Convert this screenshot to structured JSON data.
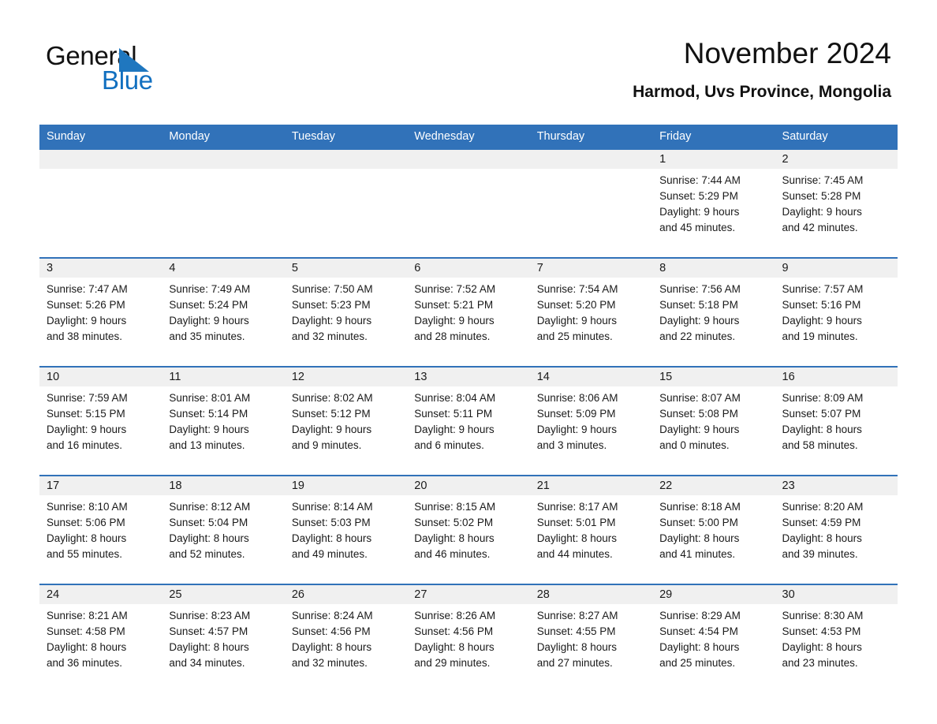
{
  "brand": {
    "name_part1": "General",
    "name_part2": "Blue",
    "accent_color": "#1270c0",
    "triangle_color": "#1f77bf"
  },
  "header": {
    "month_title": "November 2024",
    "location": "Harmod, Uvs Province, Mongolia"
  },
  "calendar": {
    "header_bg": "#3172b9",
    "daynum_bg": "#f0f0f0",
    "weekday_headers": [
      "Sunday",
      "Monday",
      "Tuesday",
      "Wednesday",
      "Thursday",
      "Friday",
      "Saturday"
    ],
    "weeks": [
      [
        {
          "day": "",
          "sunrise": "",
          "sunset": "",
          "daylight_line1": "",
          "daylight_line2": ""
        },
        {
          "day": "",
          "sunrise": "",
          "sunset": "",
          "daylight_line1": "",
          "daylight_line2": ""
        },
        {
          "day": "",
          "sunrise": "",
          "sunset": "",
          "daylight_line1": "",
          "daylight_line2": ""
        },
        {
          "day": "",
          "sunrise": "",
          "sunset": "",
          "daylight_line1": "",
          "daylight_line2": ""
        },
        {
          "day": "",
          "sunrise": "",
          "sunset": "",
          "daylight_line1": "",
          "daylight_line2": ""
        },
        {
          "day": "1",
          "sunrise": "Sunrise: 7:44 AM",
          "sunset": "Sunset: 5:29 PM",
          "daylight_line1": "Daylight: 9 hours",
          "daylight_line2": "and 45 minutes."
        },
        {
          "day": "2",
          "sunrise": "Sunrise: 7:45 AM",
          "sunset": "Sunset: 5:28 PM",
          "daylight_line1": "Daylight: 9 hours",
          "daylight_line2": "and 42 minutes."
        }
      ],
      [
        {
          "day": "3",
          "sunrise": "Sunrise: 7:47 AM",
          "sunset": "Sunset: 5:26 PM",
          "daylight_line1": "Daylight: 9 hours",
          "daylight_line2": "and 38 minutes."
        },
        {
          "day": "4",
          "sunrise": "Sunrise: 7:49 AM",
          "sunset": "Sunset: 5:24 PM",
          "daylight_line1": "Daylight: 9 hours",
          "daylight_line2": "and 35 minutes."
        },
        {
          "day": "5",
          "sunrise": "Sunrise: 7:50 AM",
          "sunset": "Sunset: 5:23 PM",
          "daylight_line1": "Daylight: 9 hours",
          "daylight_line2": "and 32 minutes."
        },
        {
          "day": "6",
          "sunrise": "Sunrise: 7:52 AM",
          "sunset": "Sunset: 5:21 PM",
          "daylight_line1": "Daylight: 9 hours",
          "daylight_line2": "and 28 minutes."
        },
        {
          "day": "7",
          "sunrise": "Sunrise: 7:54 AM",
          "sunset": "Sunset: 5:20 PM",
          "daylight_line1": "Daylight: 9 hours",
          "daylight_line2": "and 25 minutes."
        },
        {
          "day": "8",
          "sunrise": "Sunrise: 7:56 AM",
          "sunset": "Sunset: 5:18 PM",
          "daylight_line1": "Daylight: 9 hours",
          "daylight_line2": "and 22 minutes."
        },
        {
          "day": "9",
          "sunrise": "Sunrise: 7:57 AM",
          "sunset": "Sunset: 5:16 PM",
          "daylight_line1": "Daylight: 9 hours",
          "daylight_line2": "and 19 minutes."
        }
      ],
      [
        {
          "day": "10",
          "sunrise": "Sunrise: 7:59 AM",
          "sunset": "Sunset: 5:15 PM",
          "daylight_line1": "Daylight: 9 hours",
          "daylight_line2": "and 16 minutes."
        },
        {
          "day": "11",
          "sunrise": "Sunrise: 8:01 AM",
          "sunset": "Sunset: 5:14 PM",
          "daylight_line1": "Daylight: 9 hours",
          "daylight_line2": "and 13 minutes."
        },
        {
          "day": "12",
          "sunrise": "Sunrise: 8:02 AM",
          "sunset": "Sunset: 5:12 PM",
          "daylight_line1": "Daylight: 9 hours",
          "daylight_line2": "and 9 minutes."
        },
        {
          "day": "13",
          "sunrise": "Sunrise: 8:04 AM",
          "sunset": "Sunset: 5:11 PM",
          "daylight_line1": "Daylight: 9 hours",
          "daylight_line2": "and 6 minutes."
        },
        {
          "day": "14",
          "sunrise": "Sunrise: 8:06 AM",
          "sunset": "Sunset: 5:09 PM",
          "daylight_line1": "Daylight: 9 hours",
          "daylight_line2": "and 3 minutes."
        },
        {
          "day": "15",
          "sunrise": "Sunrise: 8:07 AM",
          "sunset": "Sunset: 5:08 PM",
          "daylight_line1": "Daylight: 9 hours",
          "daylight_line2": "and 0 minutes."
        },
        {
          "day": "16",
          "sunrise": "Sunrise: 8:09 AM",
          "sunset": "Sunset: 5:07 PM",
          "daylight_line1": "Daylight: 8 hours",
          "daylight_line2": "and 58 minutes."
        }
      ],
      [
        {
          "day": "17",
          "sunrise": "Sunrise: 8:10 AM",
          "sunset": "Sunset: 5:06 PM",
          "daylight_line1": "Daylight: 8 hours",
          "daylight_line2": "and 55 minutes."
        },
        {
          "day": "18",
          "sunrise": "Sunrise: 8:12 AM",
          "sunset": "Sunset: 5:04 PM",
          "daylight_line1": "Daylight: 8 hours",
          "daylight_line2": "and 52 minutes."
        },
        {
          "day": "19",
          "sunrise": "Sunrise: 8:14 AM",
          "sunset": "Sunset: 5:03 PM",
          "daylight_line1": "Daylight: 8 hours",
          "daylight_line2": "and 49 minutes."
        },
        {
          "day": "20",
          "sunrise": "Sunrise: 8:15 AM",
          "sunset": "Sunset: 5:02 PM",
          "daylight_line1": "Daylight: 8 hours",
          "daylight_line2": "and 46 minutes."
        },
        {
          "day": "21",
          "sunrise": "Sunrise: 8:17 AM",
          "sunset": "Sunset: 5:01 PM",
          "daylight_line1": "Daylight: 8 hours",
          "daylight_line2": "and 44 minutes."
        },
        {
          "day": "22",
          "sunrise": "Sunrise: 8:18 AM",
          "sunset": "Sunset: 5:00 PM",
          "daylight_line1": "Daylight: 8 hours",
          "daylight_line2": "and 41 minutes."
        },
        {
          "day": "23",
          "sunrise": "Sunrise: 8:20 AM",
          "sunset": "Sunset: 4:59 PM",
          "daylight_line1": "Daylight: 8 hours",
          "daylight_line2": "and 39 minutes."
        }
      ],
      [
        {
          "day": "24",
          "sunrise": "Sunrise: 8:21 AM",
          "sunset": "Sunset: 4:58 PM",
          "daylight_line1": "Daylight: 8 hours",
          "daylight_line2": "and 36 minutes."
        },
        {
          "day": "25",
          "sunrise": "Sunrise: 8:23 AM",
          "sunset": "Sunset: 4:57 PM",
          "daylight_line1": "Daylight: 8 hours",
          "daylight_line2": "and 34 minutes."
        },
        {
          "day": "26",
          "sunrise": "Sunrise: 8:24 AM",
          "sunset": "Sunset: 4:56 PM",
          "daylight_line1": "Daylight: 8 hours",
          "daylight_line2": "and 32 minutes."
        },
        {
          "day": "27",
          "sunrise": "Sunrise: 8:26 AM",
          "sunset": "Sunset: 4:56 PM",
          "daylight_line1": "Daylight: 8 hours",
          "daylight_line2": "and 29 minutes."
        },
        {
          "day": "28",
          "sunrise": "Sunrise: 8:27 AM",
          "sunset": "Sunset: 4:55 PM",
          "daylight_line1": "Daylight: 8 hours",
          "daylight_line2": "and 27 minutes."
        },
        {
          "day": "29",
          "sunrise": "Sunrise: 8:29 AM",
          "sunset": "Sunset: 4:54 PM",
          "daylight_line1": "Daylight: 8 hours",
          "daylight_line2": "and 25 minutes."
        },
        {
          "day": "30",
          "sunrise": "Sunrise: 8:30 AM",
          "sunset": "Sunset: 4:53 PM",
          "daylight_line1": "Daylight: 8 hours",
          "daylight_line2": "and 23 minutes."
        }
      ]
    ]
  }
}
